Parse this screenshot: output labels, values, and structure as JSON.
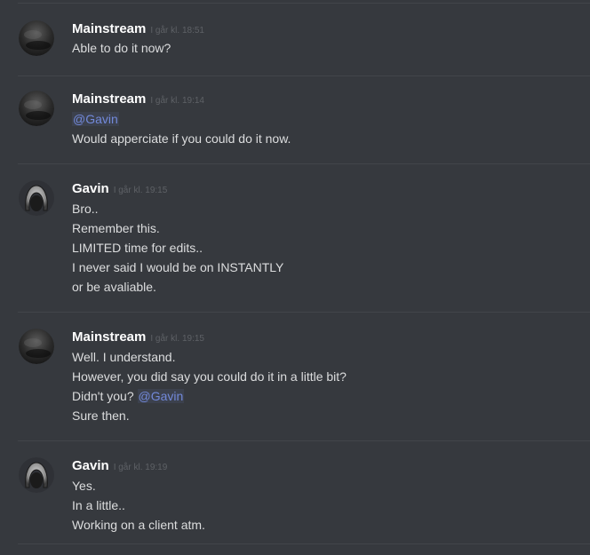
{
  "messages": [
    {
      "author": "Mainstream",
      "timestamp": "I går kl. 18:51",
      "avatar": "mainstream-avatar",
      "lines": [
        {
          "text": "Able to do it now?"
        }
      ]
    },
    {
      "author": "Mainstream",
      "timestamp": "I går kl. 19:14",
      "avatar": "mainstream-avatar",
      "lines": [
        {
          "mention": "@Gavin"
        },
        {
          "text": "Would apperciate if you could do it now."
        }
      ]
    },
    {
      "author": "Gavin",
      "timestamp": "I går kl. 19:15",
      "avatar": "gavin-avatar",
      "lines": [
        {
          "text": "Bro.."
        },
        {
          "text": "Remember this."
        },
        {
          "text": "LIMITED time for edits.."
        },
        {
          "text": "I never said I would be on INSTANTLY"
        },
        {
          "text": "or be avaliable."
        }
      ]
    },
    {
      "author": "Mainstream",
      "timestamp": "I går kl. 19:15",
      "avatar": "mainstream-avatar",
      "lines": [
        {
          "text": "Well. I understand."
        },
        {
          "text": "However, you did say you could do it in a little bit?"
        },
        {
          "text": "Didn't you? ",
          "mention": "@Gavin"
        },
        {
          "text": "Sure then."
        }
      ]
    },
    {
      "author": "Gavin",
      "timestamp": "I går kl. 19:19",
      "avatar": "gavin-avatar",
      "lines": [
        {
          "text": "Yes."
        },
        {
          "text": "In a little.."
        },
        {
          "text": "Working on a client atm."
        }
      ]
    }
  ],
  "colors": {
    "background": "#36393e",
    "divider": "#42454a",
    "username": "#ffffff",
    "timestamp": "#5e6166",
    "message_text": "#dcddde",
    "mention": "#7289da"
  }
}
